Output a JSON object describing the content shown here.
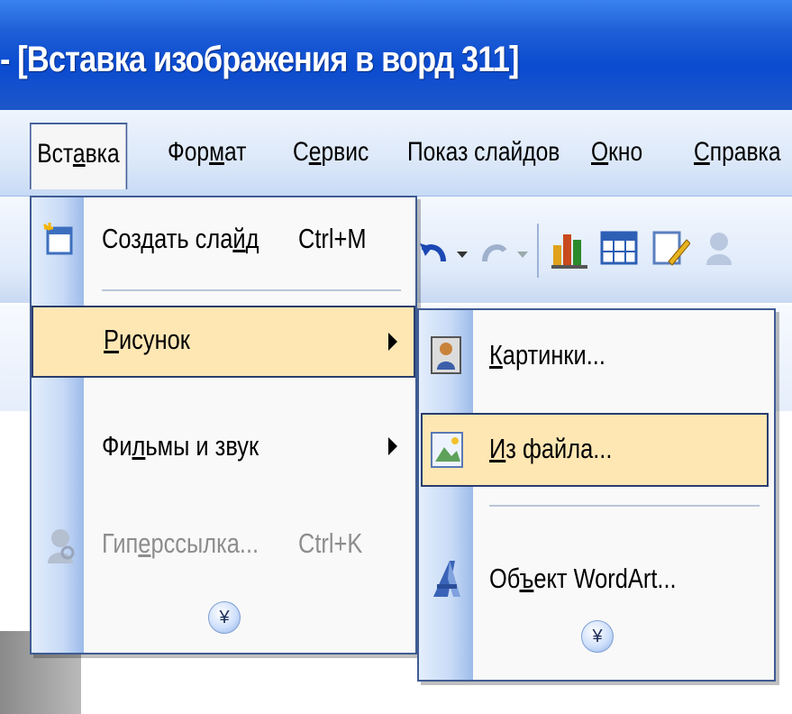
{
  "window": {
    "title": "- [Вставка изображения в ворд 311]"
  },
  "menubar": {
    "items": [
      {
        "pre": "Вст",
        "u": "а",
        "post": "вка"
      },
      {
        "pre": "Фор",
        "u": "м",
        "post": "ат"
      },
      {
        "pre": "С",
        "u": "е",
        "post": "рвис"
      },
      {
        "pre": "Показ слай",
        "u": "д",
        "post": "ов"
      },
      {
        "pre": "",
        "u": "О",
        "post": "кно"
      },
      {
        "pre": "",
        "u": "С",
        "post": "правка"
      }
    ]
  },
  "insert_menu": {
    "items": [
      {
        "pre": "Создать сла",
        "u": "й",
        "post": "д",
        "shortcut": "Ctrl+M",
        "icon": "new-slide-icon",
        "enabled": true
      },
      {
        "pre": "",
        "u": "Р",
        "post": "исунок",
        "submenu": true,
        "highlighted": true,
        "enabled": true
      },
      {
        "pre": "Фи",
        "u": "л",
        "post": "ьмы и звук",
        "submenu": true,
        "enabled": true
      },
      {
        "pre": "Гип",
        "u": "е",
        "post": "рссылка...",
        "shortcut": "Ctrl+K",
        "icon": "hyperlink-icon",
        "enabled": false
      }
    ],
    "expand_glyph": "¥"
  },
  "picture_submenu": {
    "items": [
      {
        "pre": "",
        "u": "К",
        "post": "артинки...",
        "icon": "clipart-icon"
      },
      {
        "pre": "",
        "u": "И",
        "post": "з файла...",
        "icon": "from-file-icon",
        "highlighted": true
      },
      {
        "pre": "Об",
        "u": "ъ",
        "post": "ект WordArt...",
        "icon": "wordart-icon"
      }
    ],
    "expand_glyph": "¥"
  },
  "colors": {
    "highlight": "#ffe7b4",
    "menu_border": "#3f5c93",
    "titlebar": "#0a4bd0"
  }
}
